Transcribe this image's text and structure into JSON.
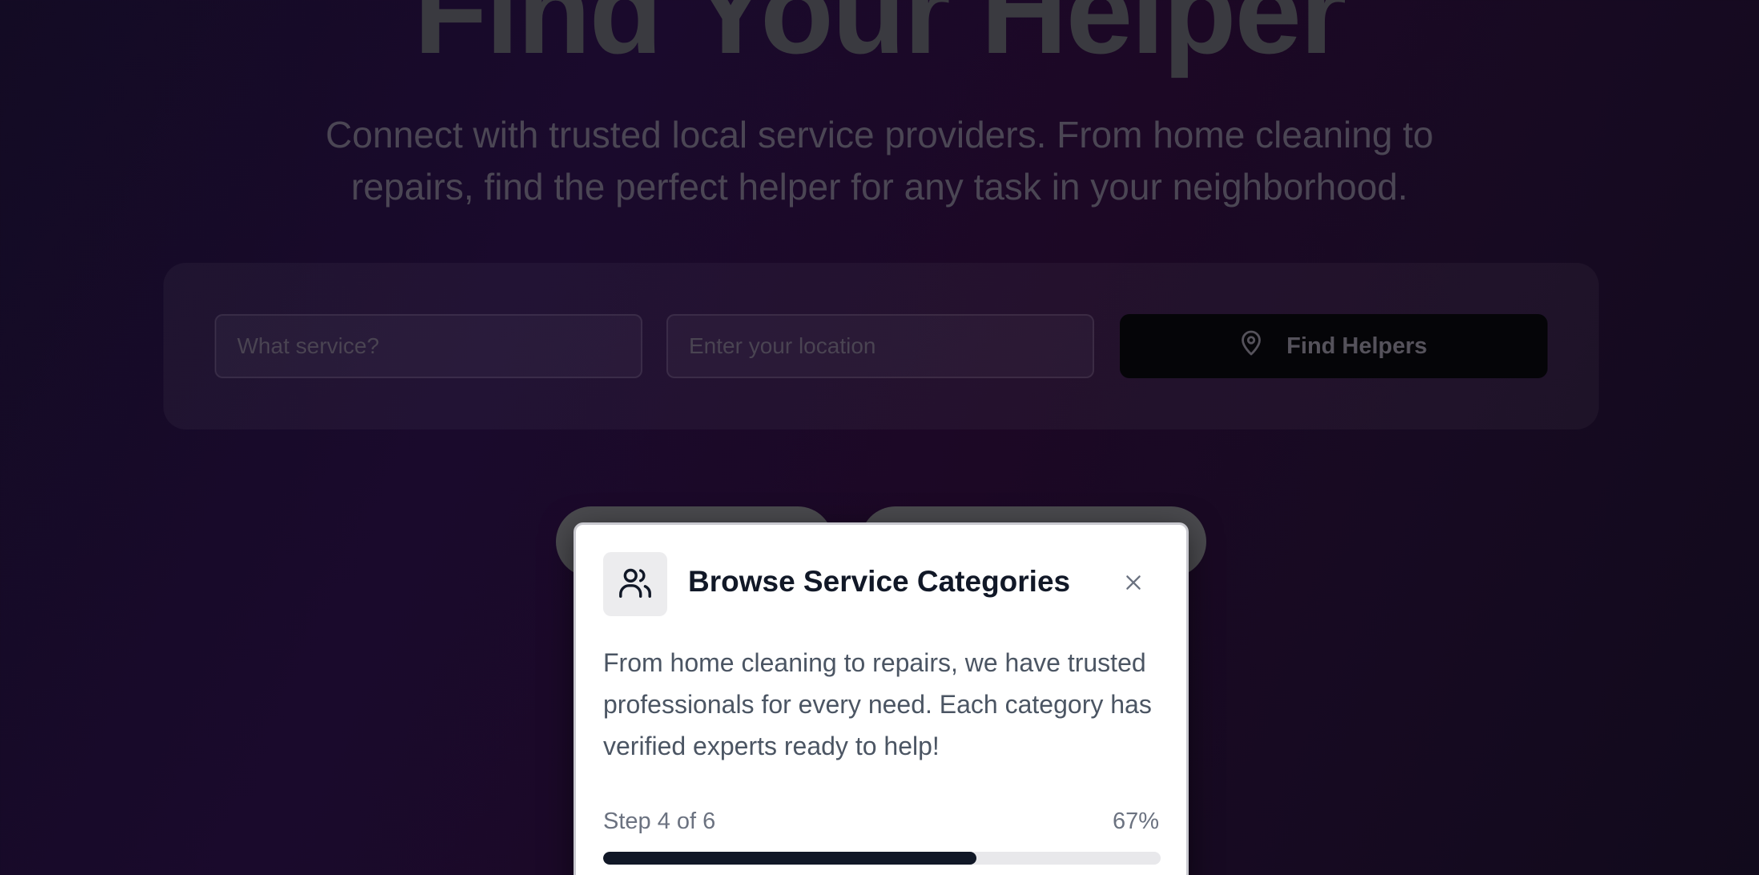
{
  "hero": {
    "title": "Find Your Helper",
    "subtitle": "Connect with trusted local service providers. From home cleaning to repairs, find the perfect helper for any task in your neighborhood."
  },
  "search": {
    "service_placeholder": "What service?",
    "location_placeholder": "Enter your location",
    "button_label": "Find Helpers",
    "button_icon": "map-pin-icon"
  },
  "tour": {
    "icon": "users-icon",
    "title": "Browse Service Categories",
    "body": "From home cleaning to repairs, we have trusted professionals for every need. Each category has verified experts ready to help!",
    "step_label": "Step 4 of 6",
    "percent_label": "67%",
    "progress": 0.67,
    "close_icon": "close-icon"
  },
  "colors": {
    "card_bg": "#ffffff",
    "progress_fill": "#111827",
    "progress_track": "#e8e8eb"
  }
}
